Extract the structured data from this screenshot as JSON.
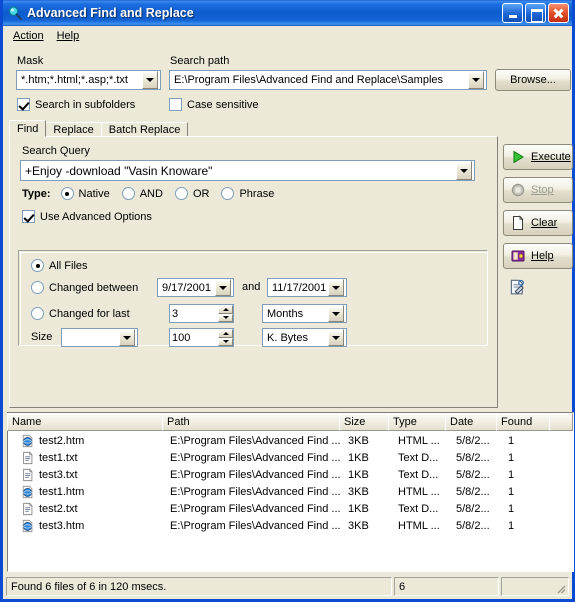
{
  "window": {
    "title": "Advanced Find and Replace",
    "icon": "magnifier-icon",
    "minimize": "Minimize",
    "maximize": "Maximize",
    "close": "Close"
  },
  "menu": [
    {
      "label": "Action",
      "accel": "A"
    },
    {
      "label": "Help",
      "accel": "H"
    }
  ],
  "form": {
    "mask_label": "Mask",
    "mask_value": "*.htm;*.html;*.asp;*.txt",
    "path_label": "Search path",
    "path_value": "E:\\Program Files\\Advanced Find and Replace\\Samples",
    "browse_label": "Browse...",
    "subfolders_label": "Search in subfolders",
    "subfolders_checked": true,
    "case_label": "Case sensitive",
    "case_checked": false
  },
  "tabs": [
    {
      "label": "Find",
      "active": true
    },
    {
      "label": "Replace",
      "active": false
    },
    {
      "label": "Batch Replace",
      "active": false
    }
  ],
  "find": {
    "query_label": "Search Query",
    "query_value": "+Enjoy -download \"Vasin Knoware\"",
    "type_label": "Type:",
    "types": [
      {
        "label": "Native",
        "selected": true
      },
      {
        "label": "AND",
        "selected": false
      },
      {
        "label": "OR",
        "selected": false
      },
      {
        "label": "Phrase",
        "selected": false
      }
    ],
    "advanced_label": "Use Advanced Options",
    "advanced_checked": true,
    "advanced": {
      "all_files_label": "All Files",
      "all_files_selected": true,
      "changed_between_label": "Changed between",
      "changed_between_selected": false,
      "date_from": "9/17/2001",
      "and_label": "and",
      "date_to": "11/17/2001",
      "changed_last_label": "Changed for last",
      "changed_last_selected": false,
      "last_count": "3",
      "last_unit": "Months",
      "size_label": "Size",
      "size_op": "",
      "size_value": "100",
      "size_unit": "K. Bytes"
    }
  },
  "actions": [
    {
      "label": "Execute",
      "accel": "E",
      "icon": "play-icon",
      "disabled": false
    },
    {
      "label": "Stop",
      "accel": "S",
      "icon": "stop-icon",
      "disabled": true
    },
    {
      "label": "Clear",
      "accel": "C",
      "icon": "page-icon",
      "disabled": false
    },
    {
      "label": "Help",
      "accel": "H",
      "icon": "book-icon",
      "disabled": false
    }
  ],
  "preview_icon": "preview-document-icon",
  "results": {
    "columns": [
      "Name",
      "Path",
      "Size",
      "Type",
      "Date",
      "Found",
      ""
    ],
    "rows": [
      {
        "icon": "html-file-icon",
        "name": "test2.htm",
        "path": "E:\\Program Files\\Advanced Find ...",
        "size": "3KB",
        "type": "HTML ...",
        "date": "5/8/2...",
        "found": "1"
      },
      {
        "icon": "text-file-icon",
        "name": "test1.txt",
        "path": "E:\\Program Files\\Advanced Find ...",
        "size": "1KB",
        "type": "Text D...",
        "date": "5/8/2...",
        "found": "1"
      },
      {
        "icon": "text-file-icon",
        "name": "test3.txt",
        "path": "E:\\Program Files\\Advanced Find ...",
        "size": "1KB",
        "type": "Text D...",
        "date": "5/8/2...",
        "found": "1"
      },
      {
        "icon": "html-file-icon",
        "name": "test1.htm",
        "path": "E:\\Program Files\\Advanced Find ...",
        "size": "3KB",
        "type": "HTML ...",
        "date": "5/8/2...",
        "found": "1"
      },
      {
        "icon": "text-file-icon",
        "name": "test2.txt",
        "path": "E:\\Program Files\\Advanced Find ...",
        "size": "1KB",
        "type": "Text D...",
        "date": "5/8/2...",
        "found": "1"
      },
      {
        "icon": "html-file-icon",
        "name": "test3.htm",
        "path": "E:\\Program Files\\Advanced Find ...",
        "size": "3KB",
        "type": "HTML ...",
        "date": "5/8/2...",
        "found": "1"
      }
    ]
  },
  "status": {
    "message": "Found 6 files of 6 in 120 msecs.",
    "count": "6",
    "extra": ""
  },
  "colors": {
    "title_blue": "#0a4bd4",
    "face": "#ece9d8",
    "field_border": "#7f9db9",
    "execute_green": "#1fa81f"
  }
}
